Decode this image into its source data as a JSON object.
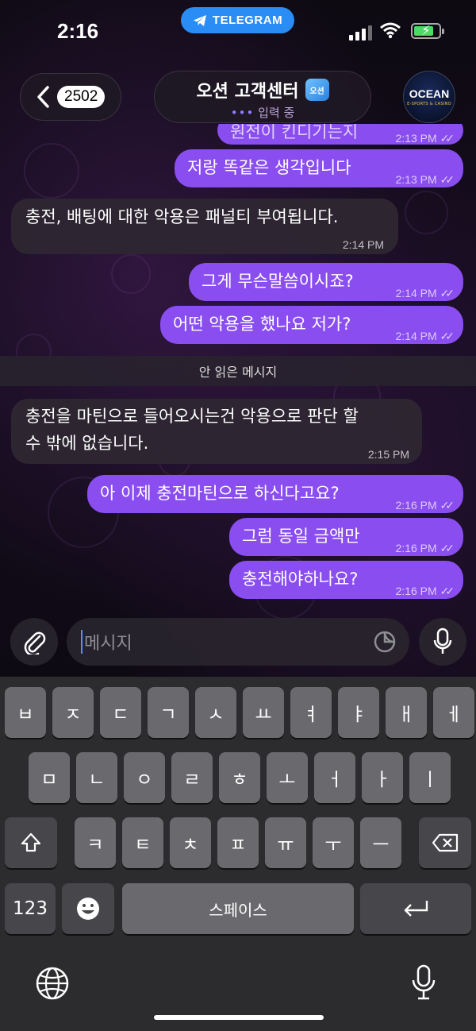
{
  "status_bar": {
    "time": "2:16",
    "app_pill": "TELEGRAM"
  },
  "header": {
    "unread_count": "2502",
    "title": "오션 고객센터",
    "title_badge": "오션",
    "typing_status": "입력 중",
    "avatar_brand": "OCEAN",
    "avatar_subtitle": "E-SPORTS & CASINO"
  },
  "messages": [
    {
      "text": "원전이 킨디기는지",
      "time": "2:13 PM",
      "dir": "out"
    },
    {
      "text": "저랑 똑같은 생각입니다",
      "time": "2:13 PM",
      "dir": "out"
    },
    {
      "text": "충전, 배팅에 대한 악용은 패널티 부여됩니다.",
      "time": "2:14 PM",
      "dir": "in"
    },
    {
      "text": "그게 무슨말씀이시죠?",
      "time": "2:14 PM",
      "dir": "out"
    },
    {
      "text": "어떤 악용을 했나요 저가?",
      "time": "2:14 PM",
      "dir": "out"
    },
    {
      "text": "충전을 마틴으로 들어오시는건 악용으로 판단 할",
      "text2": "수 밖에 없습니다.",
      "time": "2:15 PM",
      "dir": "in"
    },
    {
      "text": "아 이제 충전마틴으로 하신다고요?",
      "time": "2:16 PM",
      "dir": "out"
    },
    {
      "text": "그럼 동일 금액만",
      "time": "2:16 PM",
      "dir": "out"
    },
    {
      "text": "충전해야하나요?",
      "time": "2:16 PM",
      "dir": "out"
    }
  ],
  "unread_divider": "안 읽은 메시지",
  "input": {
    "placeholder": "메시지"
  },
  "keyboard": {
    "row1": [
      "ㅂ",
      "ㅈ",
      "ㄷ",
      "ㄱ",
      "ㅅ",
      "ㅛ",
      "ㅕ",
      "ㅑ",
      "ㅐ",
      "ㅔ"
    ],
    "row2": [
      "ㅁ",
      "ㄴ",
      "ㅇ",
      "ㄹ",
      "ㅎ",
      "ㅗ",
      "ㅓ",
      "ㅏ",
      "ㅣ"
    ],
    "row3": [
      "ㅋ",
      "ㅌ",
      "ㅊ",
      "ㅍ",
      "ㅠ",
      "ㅜ",
      "ㅡ"
    ],
    "numbers_key": "123",
    "space_key": "스페이스"
  },
  "colors": {
    "outgoing_bubble": "#8a4ef0",
    "incoming_bubble": "#2e2832",
    "telegram_blue": "#2a8cf5"
  }
}
